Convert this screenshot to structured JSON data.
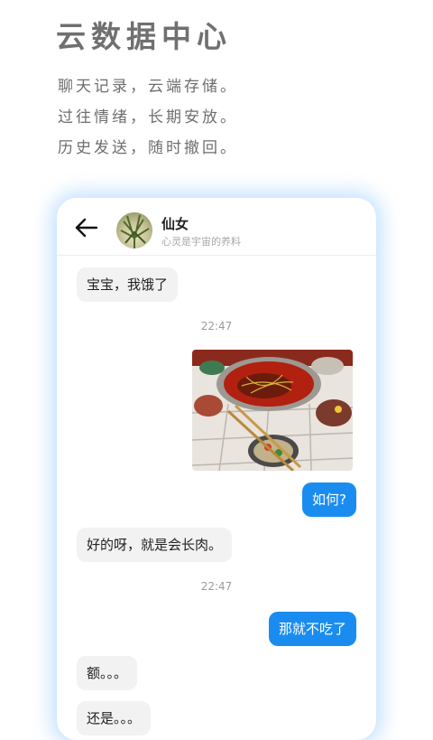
{
  "hero": {
    "title": "云数据中心",
    "lines": [
      "聊天记录，云端存储。",
      "过往情绪，长期安放。",
      "历史发送，随时撤回。"
    ]
  },
  "chat": {
    "contact_name": "仙女",
    "contact_status": "心灵是宇宙的养料",
    "messages": [
      {
        "text": "宝宝，我饿了"
      },
      {
        "time": "22:47"
      },
      {
        "text": "如何?"
      },
      {
        "text": "好的呀，就是会长肉。"
      },
      {
        "time": "22:47"
      },
      {
        "text": "那就不吃了"
      },
      {
        "text": "额。。。"
      },
      {
        "text": "还是。。。"
      }
    ]
  },
  "colors": {
    "accent": "#1a8cf0",
    "incoming_bubble": "#f2f2f2",
    "card_glow": "#78b9ff"
  },
  "icons": [
    "back-arrow-icon",
    "avatar",
    "hotpot-photo"
  ]
}
